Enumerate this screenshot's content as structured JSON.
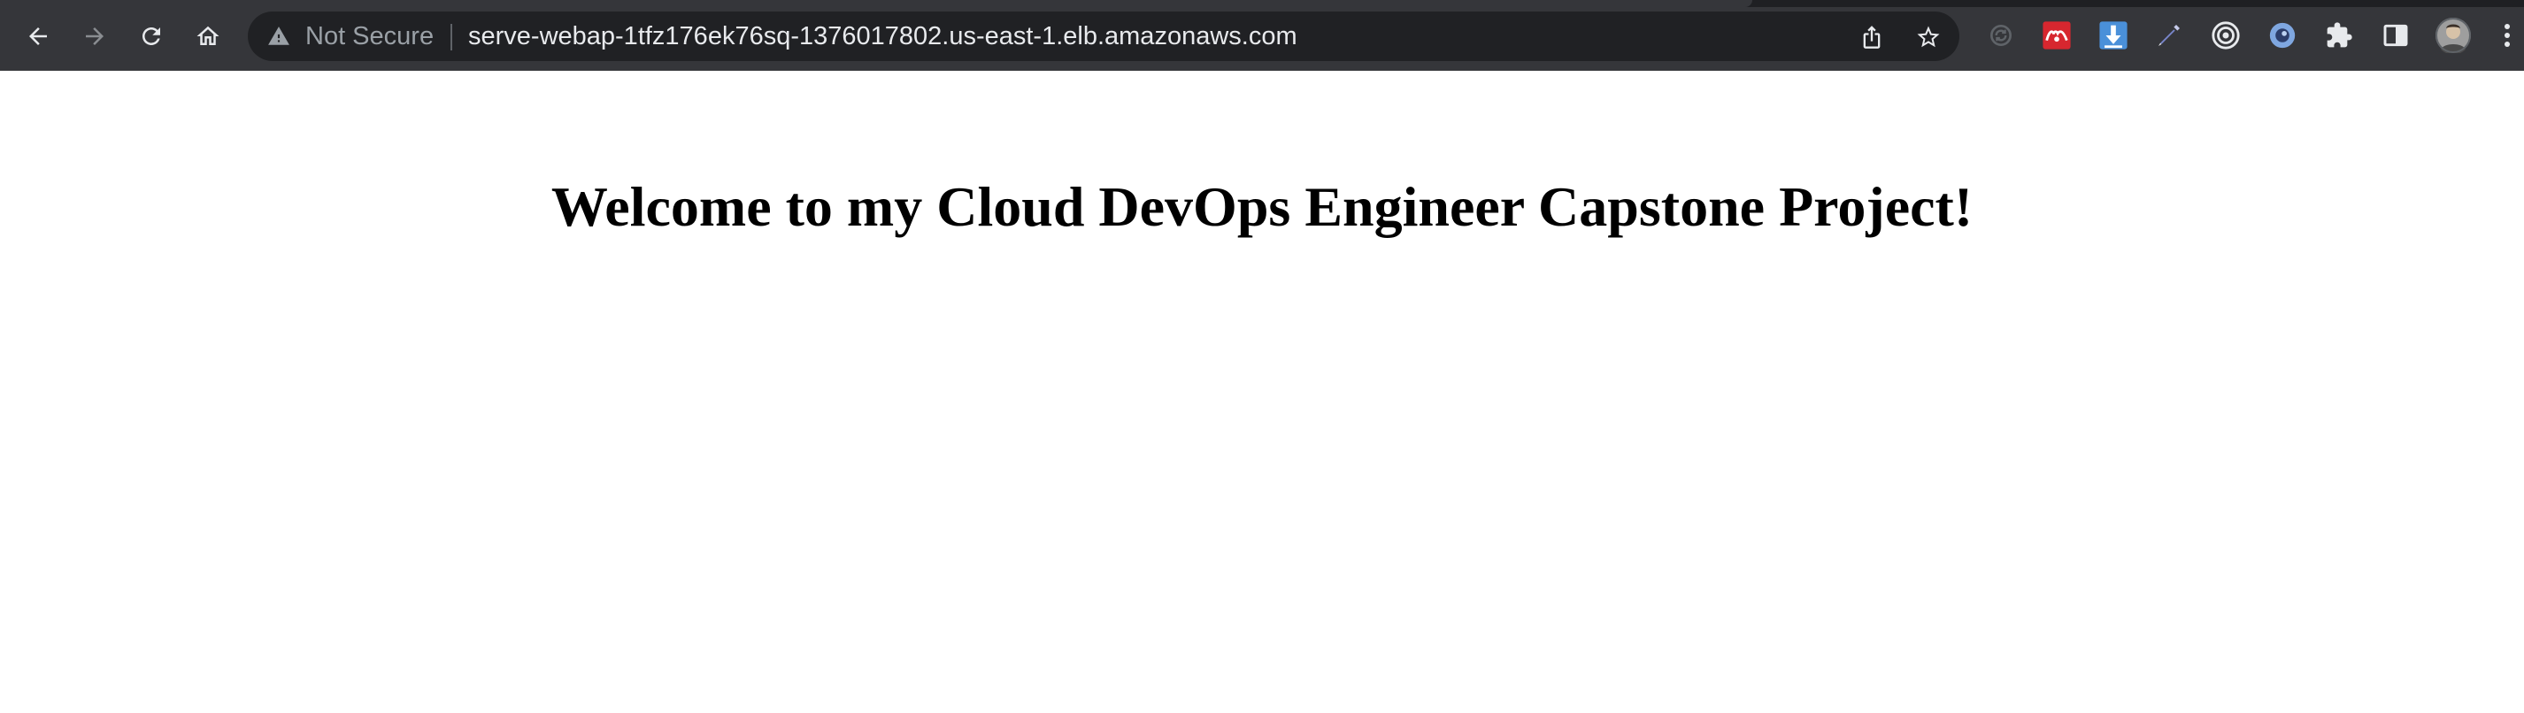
{
  "browser": {
    "security_label": "Not Secure",
    "url": "serve-webap-1tfz176ek76sq-1376017802.us-east-1.elb.amazonaws.com",
    "nav_icons": [
      "back-icon",
      "forward-icon",
      "reload-icon",
      "home-icon"
    ],
    "omnibox_icons": [
      "warning-icon",
      "share-icon",
      "bookmark-star-icon"
    ],
    "extension_icons": [
      "sync-extension-icon",
      "mendeley-extension-icon",
      "downloader-extension-icon",
      "color-picker-extension-icon",
      "target-extension-icon",
      "blue-circle-extension-icon",
      "puzzle-extensions-icon",
      "side-panel-icon",
      "profile-avatar",
      "more-menu-icon"
    ],
    "colors": {
      "toolbar": "#35363a",
      "omnibox": "#202124",
      "url_text": "#e8eaed",
      "muted_text": "#9aa0a6",
      "mendeley_red": "#d7272f",
      "download_blue": "#4a90d9"
    }
  },
  "page": {
    "heading": "Welcome to my Cloud DevOps Engineer Capstone Project!",
    "background": "#ffffff"
  }
}
